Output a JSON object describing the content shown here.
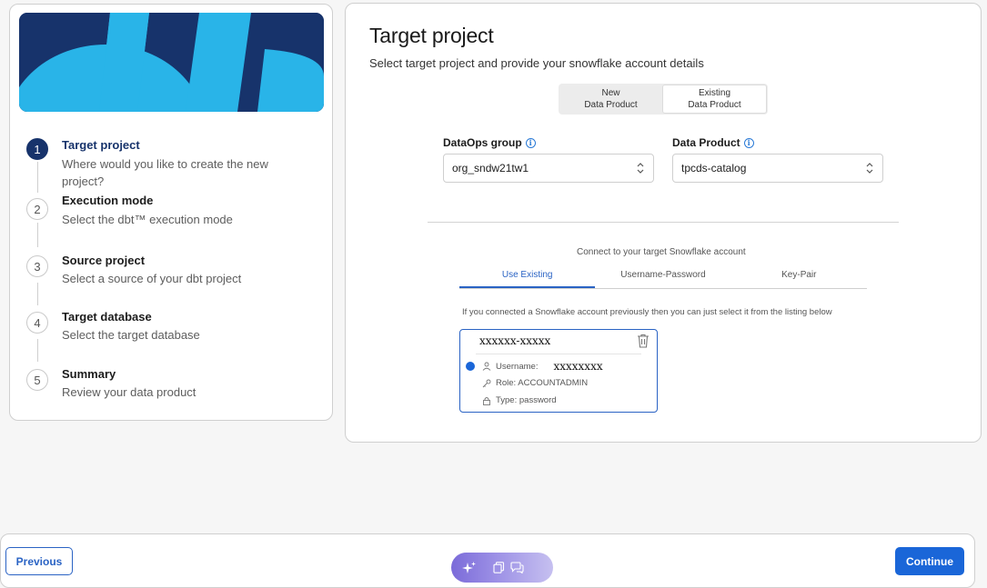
{
  "sidebar": {
    "steps": [
      {
        "number": "1",
        "title": "Target project",
        "description": "Where would you like to create the new project?"
      },
      {
        "number": "2",
        "title": "Execution mode",
        "description": "Select the dbt™ execution mode"
      },
      {
        "number": "3",
        "title": "Source project",
        "description": "Select a source of your dbt project"
      },
      {
        "number": "4",
        "title": "Target database",
        "description": "Select the target database"
      },
      {
        "number": "5",
        "title": "Summary",
        "description": "Review your data product"
      }
    ]
  },
  "main": {
    "title": "Target project",
    "subtitle": "Select target project and provide your snowflake account details",
    "segments": [
      {
        "label": "New\nData Product"
      },
      {
        "label": "Existing\nData Product"
      }
    ],
    "dataops_group": {
      "label": "DataOps group",
      "value": "org_sndw21tw1"
    },
    "data_product": {
      "label": "Data Product",
      "value": "tpcds-catalog"
    },
    "connect_label": "Connect to your target Snowflake account",
    "tabs": [
      {
        "label": "Use Existing"
      },
      {
        "label": "Username-Password"
      },
      {
        "label": "Key-Pair"
      }
    ],
    "hint": "If you connected a Snowflake account previously then you can just select it from the listing below",
    "account": {
      "name": "xxxxxx-xxxxx",
      "username_label": "Username:",
      "username_value": "xxxxxxxx",
      "role": "Role: ACCOUNTADMIN",
      "type": "Type: password"
    }
  },
  "footer": {
    "previous_label": "Previous",
    "continue_label": "Continue"
  },
  "colors": {
    "brand_navy": "#17336b",
    "brand_cyan": "#29b4e8",
    "accent_blue": "#1a66d8"
  }
}
